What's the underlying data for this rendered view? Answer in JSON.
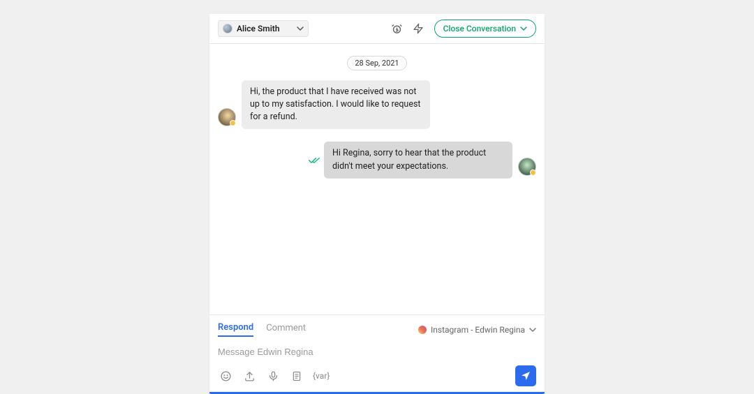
{
  "header": {
    "assignee_name": "Alice Smith",
    "close_label": "Close Conversation"
  },
  "thread": {
    "date_label": "28 Sep, 2021",
    "messages": [
      {
        "direction": "in",
        "text": "Hi, the product that I have received was not up to my satisfaction. I would like to request for a refund."
      },
      {
        "direction": "out",
        "text": "Hi Regina, sorry to hear that the product didn't meet your expectations."
      }
    ]
  },
  "composer": {
    "tabs": {
      "respond": "Respond",
      "comment": "Comment"
    },
    "channel_label": "Instagram - Edwin Regina",
    "placeholder": "Message Edwin Regina",
    "var_label": "{var}"
  }
}
